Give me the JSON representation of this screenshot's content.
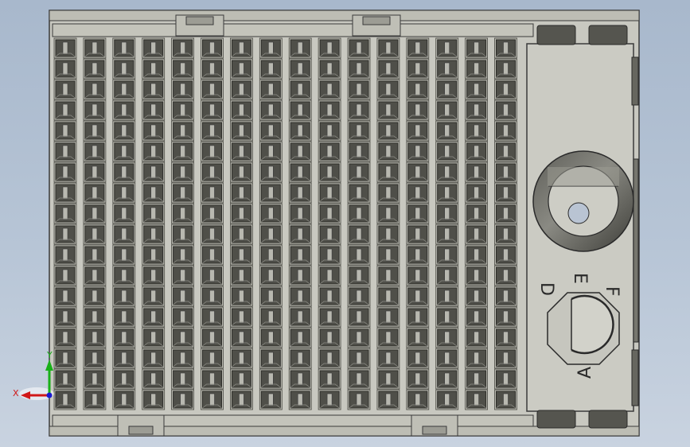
{
  "viewport": {
    "background_top": "#a8b8cc",
    "background_bottom": "#c9d3e0"
  },
  "model": {
    "body_color": "#c8c8c0",
    "edge_color": "#3a3a3a",
    "cavity_dark": "#4f4f49",
    "cavity_shadow": "#2c2c28",
    "contact_color": "#b8b8b0",
    "grid": {
      "rows": 18,
      "cols": 16
    },
    "orientation_labels": {
      "a": "A",
      "d": "D",
      "e": "E",
      "f": "F"
    }
  },
  "triad": {
    "x_label": "X",
    "y_label": "Y",
    "x_color": "#d01818",
    "y_color": "#18b018",
    "z_color": "#1a1ad0"
  }
}
